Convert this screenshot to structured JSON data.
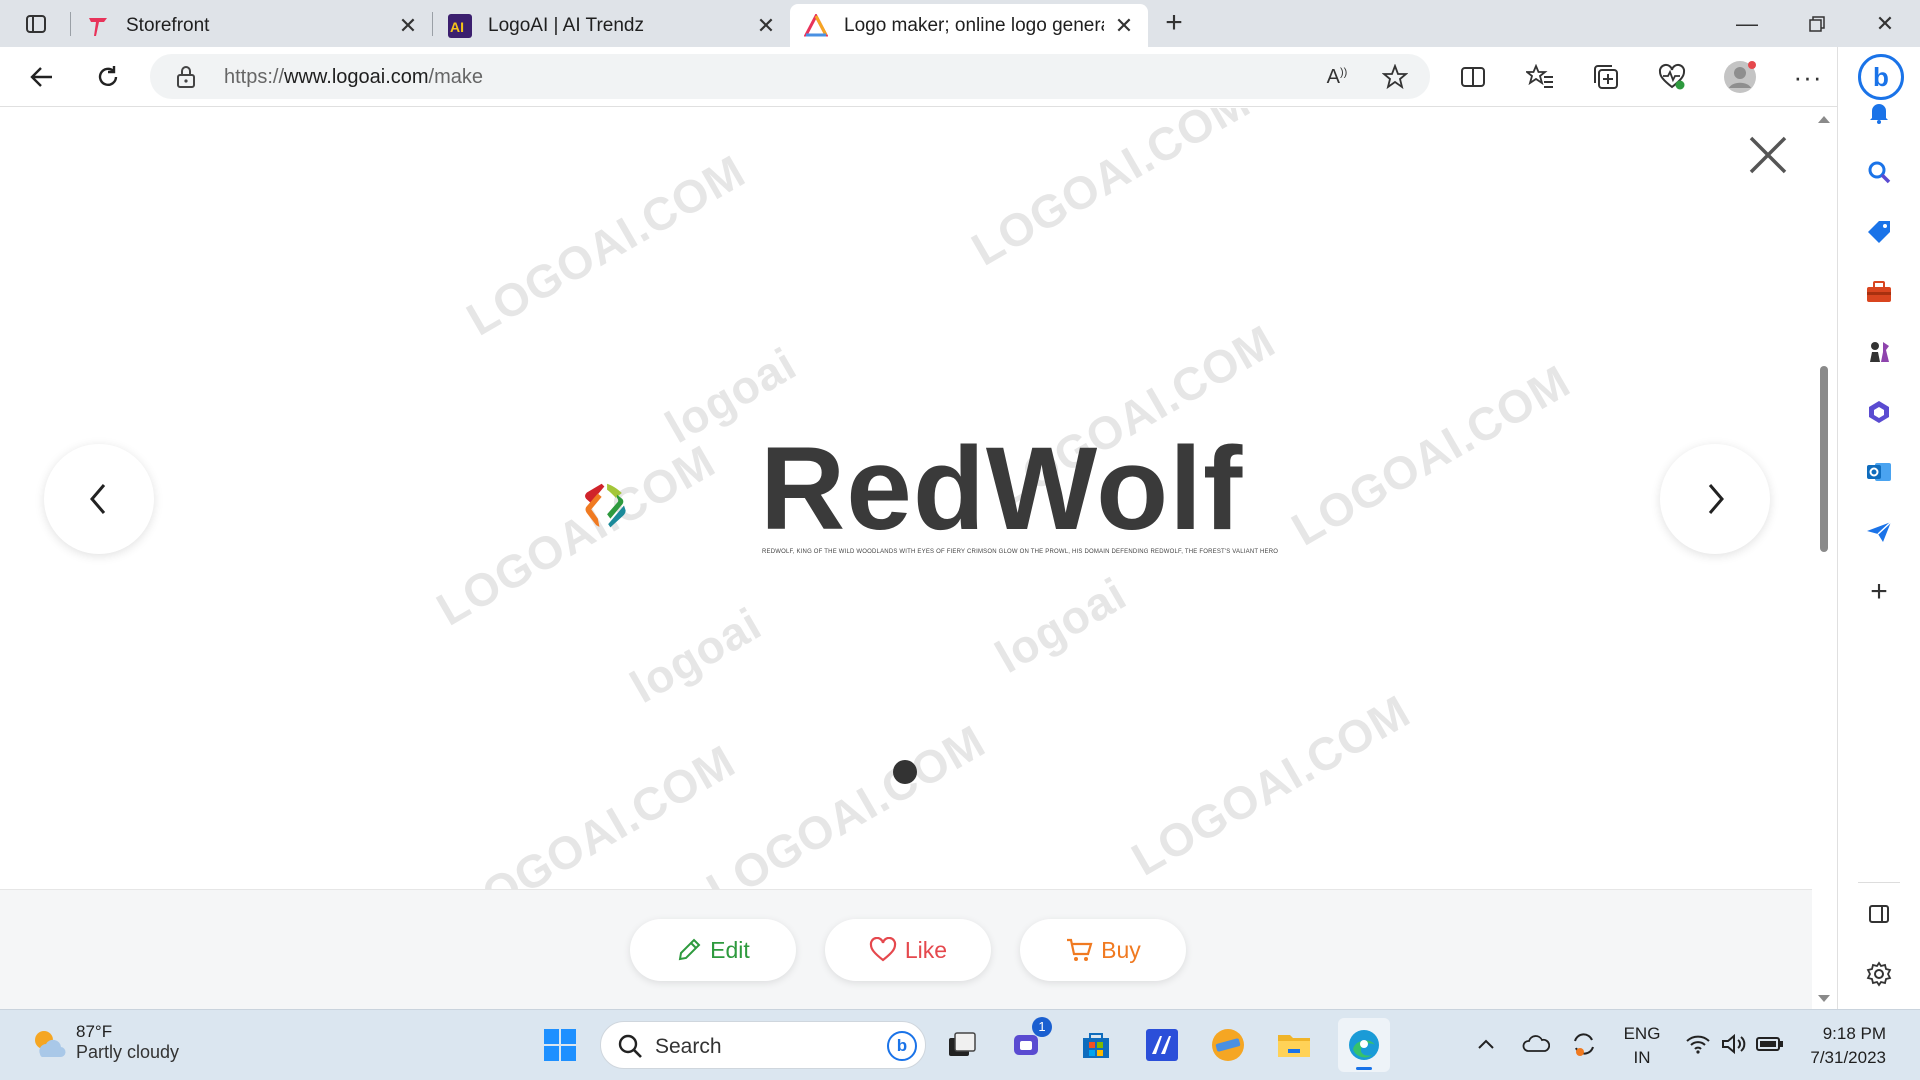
{
  "browser": {
    "tabs": [
      {
        "title": "Storefront",
        "active": false
      },
      {
        "title": "LogoAI | AI Trendz",
        "active": false
      },
      {
        "title": "Logo maker; online logo generat",
        "active": true
      }
    ],
    "url_prefix": "https://",
    "url_host": "www.logoai.com",
    "url_path": "/make"
  },
  "logo": {
    "brand": "RedWolf",
    "tagline": "REDWOLF, KING OF THE WILD WOODLANDS  WITH EYES OF FIERY CRIMSON GLOW ON THE PROWL, HIS DOMAIN DEFENDING REDWOLF, THE FOREST'S VALIANT HERO",
    "watermark_text": "LOGOAI.COM",
    "watermark_brand": "logoai"
  },
  "actions": {
    "edit": "Edit",
    "like": "Like",
    "buy": "Buy"
  },
  "colors": {
    "edit": "#2e9a3e",
    "like": "#e5484d",
    "buy": "#f07a21",
    "accent": "#1a73e8"
  },
  "taskbar": {
    "weather_temp": "87°F",
    "weather_desc": "Partly cloudy",
    "search_placeholder": "Search",
    "chat_badge": "1",
    "lang_line1": "ENG",
    "lang_line2": "IN",
    "time": "9:18 PM",
    "date": "7/31/2023"
  }
}
